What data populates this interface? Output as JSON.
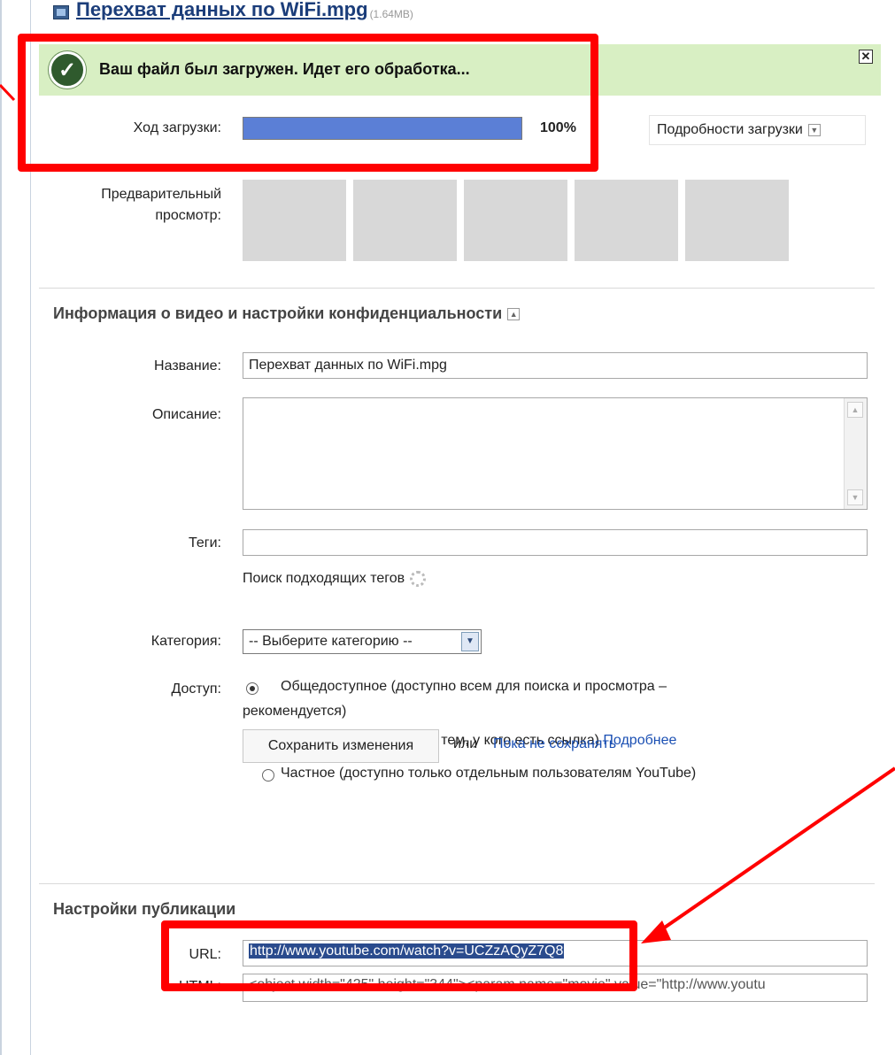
{
  "file": {
    "title": "Перехват данных по WiFi.mpg",
    "size": "(1.64MB)"
  },
  "success": {
    "message": "Ваш файл был загружен. Идет его обработка...",
    "close_symbol": "✕"
  },
  "upload": {
    "progress_label": "Ход загрузки:",
    "progress": 1.0,
    "percent_text": "100%",
    "details_button": "Подробности загрузки"
  },
  "preview": {
    "label_line1": "Предварительный",
    "label_line2": "просмотр:"
  },
  "info_section": {
    "heading": "Информация о видео и настройки конфиденциальности",
    "title_label": "Название:",
    "title_value": "Перехват данных по WiFi.mpg",
    "description_label": "Описание:",
    "description_value": "",
    "tags_label": "Теги:",
    "tags_value": "",
    "tag_search_text": "Поиск подходящих тегов",
    "category_label": "Категория:",
    "category_selected": "-- Выберите категорию --",
    "access_label": "Доступ:",
    "access_options": [
      {
        "line1": "Общедоступное (доступно всем для поиска и просмотра –",
        "line2": "рекомендуется)",
        "selected": true
      },
      {
        "text": "\"Не в списке\" (доступно тем, у кого есть ссылка)",
        "link": "Подробнее",
        "selected": false
      },
      {
        "text": "Частное (доступно только отдельным пользователям YouTube)",
        "selected": false
      }
    ],
    "save_button": "Сохранить изменения",
    "or_text": "или",
    "dont_save_link": "Пока не сохранять"
  },
  "publish_section": {
    "heading": "Настройки публикации",
    "url_label": "URL:",
    "url_value": "http://www.youtube.com/watch?v=UCZzAQyZ7Q8",
    "html_label": "HTML:",
    "html_value": "<object width=\"425\" height=\"344\"><param name=\"movie\" value=\"http://www.youtu"
  },
  "colors": {
    "accent_red": "#ff0000",
    "success_bg": "#d8efc3",
    "progress_fill": "#5b7fd6",
    "link": "#1a4fb3"
  }
}
